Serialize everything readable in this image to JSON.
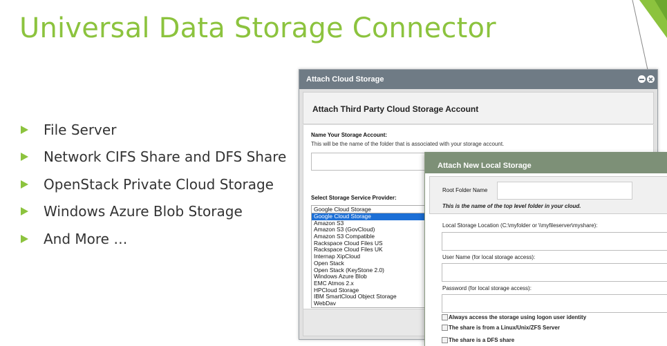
{
  "slide": {
    "title": "Universal Data Storage Connector",
    "bullets": [
      "File Server",
      "Network CIFS Share and DFS Share",
      "OpenStack Private Cloud Storage",
      "Windows Azure Blob Storage",
      "And More …"
    ],
    "accent_color": "#8cc33e"
  },
  "attach_cloud_dialog": {
    "title": "Attach Cloud Storage",
    "heading": "Attach Third Party Cloud Storage Account",
    "name_label": "Name Your Storage Account:",
    "name_help": "This will be the name of the folder that is associated with your storage account.",
    "name_value": "",
    "provider_label": "Select Storage Service Provider:",
    "provider_selected": "Google Cloud Storage",
    "provider_options": [
      "Google Cloud Storage",
      "Amazon S3",
      "Amazon S3 (GovCloud)",
      "Amazon S3 Compatible",
      "Rackspace Cloud Files US",
      "Rackspace Cloud Files UK",
      "Internap XipCloud",
      "Open Stack",
      "Open Stack (KeyStone 2.0)",
      "Windows Azure Blob",
      "EMC Atmos 2.x",
      "HPCloud Storage",
      "IBM SmartCloud Object Storage",
      "WebDav"
    ],
    "titlebar_color": "#6f7b85",
    "controls": [
      "minimize-icon",
      "close-icon"
    ]
  },
  "attach_local_dialog": {
    "title": "Attach New Local Storage",
    "root_folder_label": "Root Folder Name",
    "root_folder_value": "",
    "root_folder_help": "This is the name of the top level folder in your cloud.",
    "location_label": "Local Storage Location (C:\\myfolder or \\\\myfileserver\\myshare):",
    "location_value": "",
    "username_label": "User Name (for local storage access):",
    "username_value": "",
    "password_label": "Password (for local storage access):",
    "password_value": "",
    "checkboxes": [
      {
        "label": "Always access the storage using logon user identity",
        "checked": false
      },
      {
        "label": "The share is from a Linux/Unix/ZFS Server",
        "checked": false
      },
      {
        "label": "The share is a DFS share",
        "checked": false
      }
    ],
    "titlebar_color": "#7d9077"
  }
}
